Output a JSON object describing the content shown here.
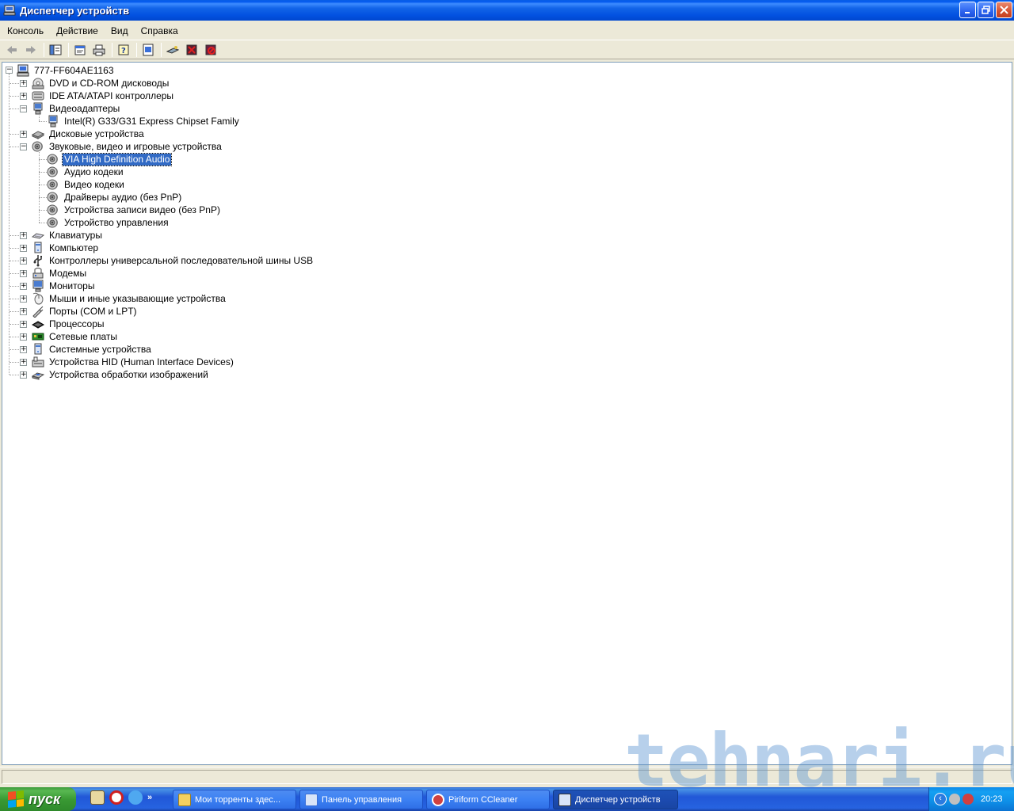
{
  "window": {
    "title": "Диспетчер устройств"
  },
  "menu": [
    "Консоль",
    "Действие",
    "Вид",
    "Справка"
  ],
  "toolbar_icons": [
    "back-icon",
    "forward-icon",
    "show-hide-tree-icon",
    "properties-icon",
    "print-icon",
    "help-icon",
    "update-driver-icon",
    "scan-hardware-icon",
    "uninstall-icon",
    "disable-icon"
  ],
  "tree": {
    "root": "777-FF604AE1163",
    "nodes": [
      {
        "label": "DVD и CD-ROM дисководы",
        "level": 1,
        "expanded": false,
        "icon": "cdrom-icon"
      },
      {
        "label": "IDE ATA/ATAPI контроллеры",
        "level": 1,
        "expanded": false,
        "icon": "ide-controller-icon"
      },
      {
        "label": "Видеоадаптеры",
        "level": 1,
        "expanded": true,
        "icon": "display-adapter-icon"
      },
      {
        "label": "Intel(R) G33/G31 Express Chipset Family",
        "level": 2,
        "icon": "display-adapter-icon"
      },
      {
        "label": "Дисковые устройства",
        "level": 1,
        "expanded": false,
        "icon": "disk-drive-icon"
      },
      {
        "label": "Звуковые, видео и игровые устройства",
        "level": 1,
        "expanded": true,
        "icon": "sound-device-icon"
      },
      {
        "label": "VIA High Definition Audio",
        "level": 2,
        "selected": true,
        "icon": "sound-device-icon"
      },
      {
        "label": "Аудио кодеки",
        "level": 2,
        "icon": "sound-device-icon"
      },
      {
        "label": "Видео кодеки",
        "level": 2,
        "icon": "sound-device-icon"
      },
      {
        "label": "Драйверы аудио (без PnP)",
        "level": 2,
        "icon": "sound-device-icon"
      },
      {
        "label": "Устройства записи видео (без PnP)",
        "level": 2,
        "icon": "sound-device-icon"
      },
      {
        "label": "Устройство управления",
        "level": 2,
        "icon": "sound-device-icon"
      },
      {
        "label": "Клавиатуры",
        "level": 1,
        "expanded": false,
        "icon": "keyboard-icon"
      },
      {
        "label": "Компьютер",
        "level": 1,
        "expanded": false,
        "icon": "computer-icon"
      },
      {
        "label": "Контроллеры универсальной последовательной шины USB",
        "level": 1,
        "expanded": false,
        "icon": "usb-icon"
      },
      {
        "label": "Модемы",
        "level": 1,
        "expanded": false,
        "icon": "modem-icon"
      },
      {
        "label": "Мониторы",
        "level": 1,
        "expanded": false,
        "icon": "monitor-icon"
      },
      {
        "label": "Мыши и иные указывающие устройства",
        "level": 1,
        "expanded": false,
        "icon": "mouse-icon"
      },
      {
        "label": "Порты (COM и LPT)",
        "level": 1,
        "expanded": false,
        "icon": "port-icon"
      },
      {
        "label": "Процессоры",
        "level": 1,
        "expanded": false,
        "icon": "processor-icon"
      },
      {
        "label": "Сетевые платы",
        "level": 1,
        "expanded": false,
        "icon": "network-card-icon"
      },
      {
        "label": "Системные устройства",
        "level": 1,
        "expanded": false,
        "icon": "system-device-icon"
      },
      {
        "label": "Устройства HID (Human Interface Devices)",
        "level": 1,
        "expanded": false,
        "icon": "hid-icon"
      },
      {
        "label": "Устройства обработки изображений",
        "level": 1,
        "expanded": false,
        "icon": "imaging-device-icon"
      }
    ]
  },
  "watermark": "tehnari.ru",
  "taskbar": {
    "start_label": "пуск",
    "quick_launch_more": "»",
    "buttons": [
      {
        "label": "Мои торренты здес...",
        "icon": "folder-icon",
        "active": false
      },
      {
        "label": "Панель управления",
        "icon": "control-panel-icon",
        "active": false
      },
      {
        "label": "Piriform CCleaner",
        "icon": "ccleaner-icon",
        "active": false
      },
      {
        "label": "Диспетчер устройств",
        "icon": "device-manager-icon",
        "active": true
      }
    ],
    "tray_chevron": "‹",
    "clock": "20:23"
  }
}
